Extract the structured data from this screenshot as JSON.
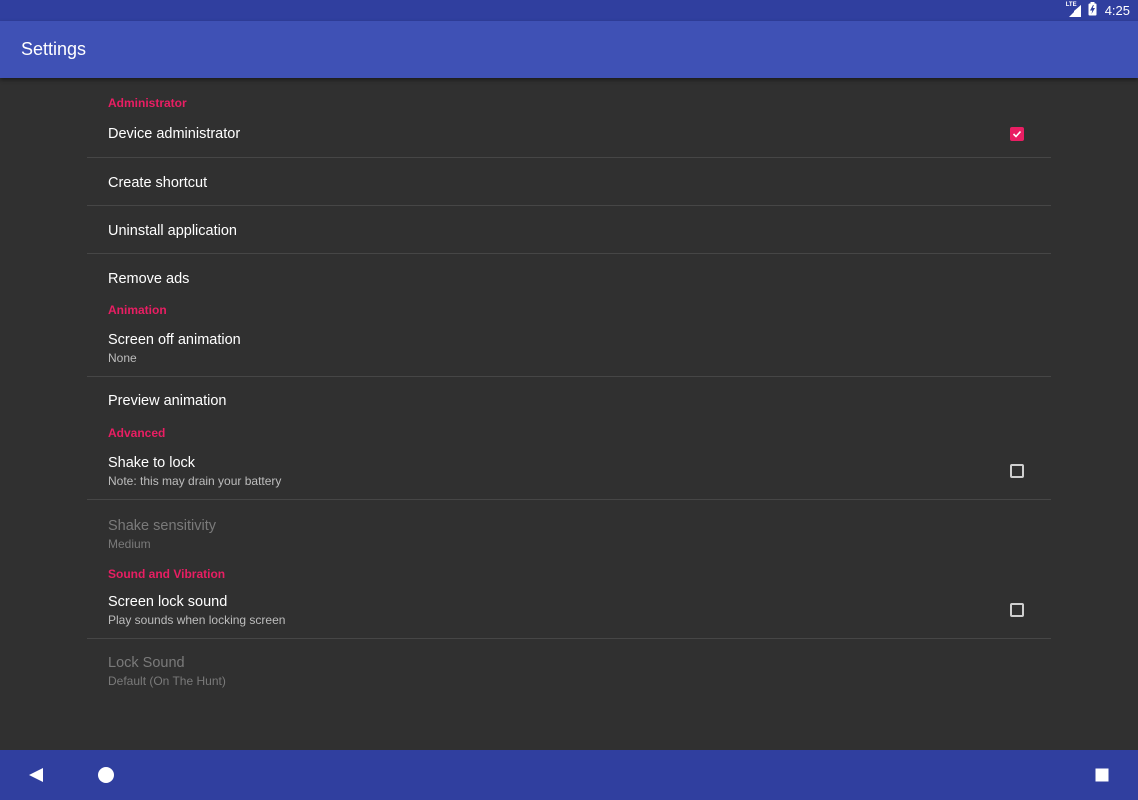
{
  "status_bar": {
    "network_label": "LTE",
    "time": "4:25"
  },
  "app_bar": {
    "title": "Settings"
  },
  "sections": {
    "administrator": {
      "header": "Administrator",
      "device_admin": {
        "title": "Device administrator",
        "checked": true
      },
      "create_shortcut": {
        "title": "Create shortcut"
      },
      "uninstall": {
        "title": "Uninstall application"
      },
      "remove_ads": {
        "title": "Remove ads"
      }
    },
    "animation": {
      "header": "Animation",
      "screen_off": {
        "title": "Screen off animation",
        "summary": "None"
      },
      "preview": {
        "title": "Preview animation"
      }
    },
    "advanced": {
      "header": "Advanced",
      "shake_to_lock": {
        "title": "Shake to lock",
        "summary": "Note: this may drain your battery",
        "checked": false
      },
      "shake_sensitivity": {
        "title": "Shake sensitivity",
        "summary": "Medium"
      }
    },
    "sound": {
      "header": "Sound and Vibration",
      "lock_sound_toggle": {
        "title": "Screen lock sound",
        "summary": "Play sounds when locking screen",
        "checked": false
      },
      "lock_sound": {
        "title": "Lock Sound",
        "summary": "Default (On The Hunt)"
      }
    }
  },
  "colors": {
    "accent": "#e91e63",
    "primary": "#3f51b5",
    "primary_dark": "#303f9f",
    "background": "#303030"
  },
  "icons": {
    "nav_back": "back-triangle-icon",
    "nav_home": "home-circle-icon",
    "nav_recents": "recents-square-icon"
  }
}
